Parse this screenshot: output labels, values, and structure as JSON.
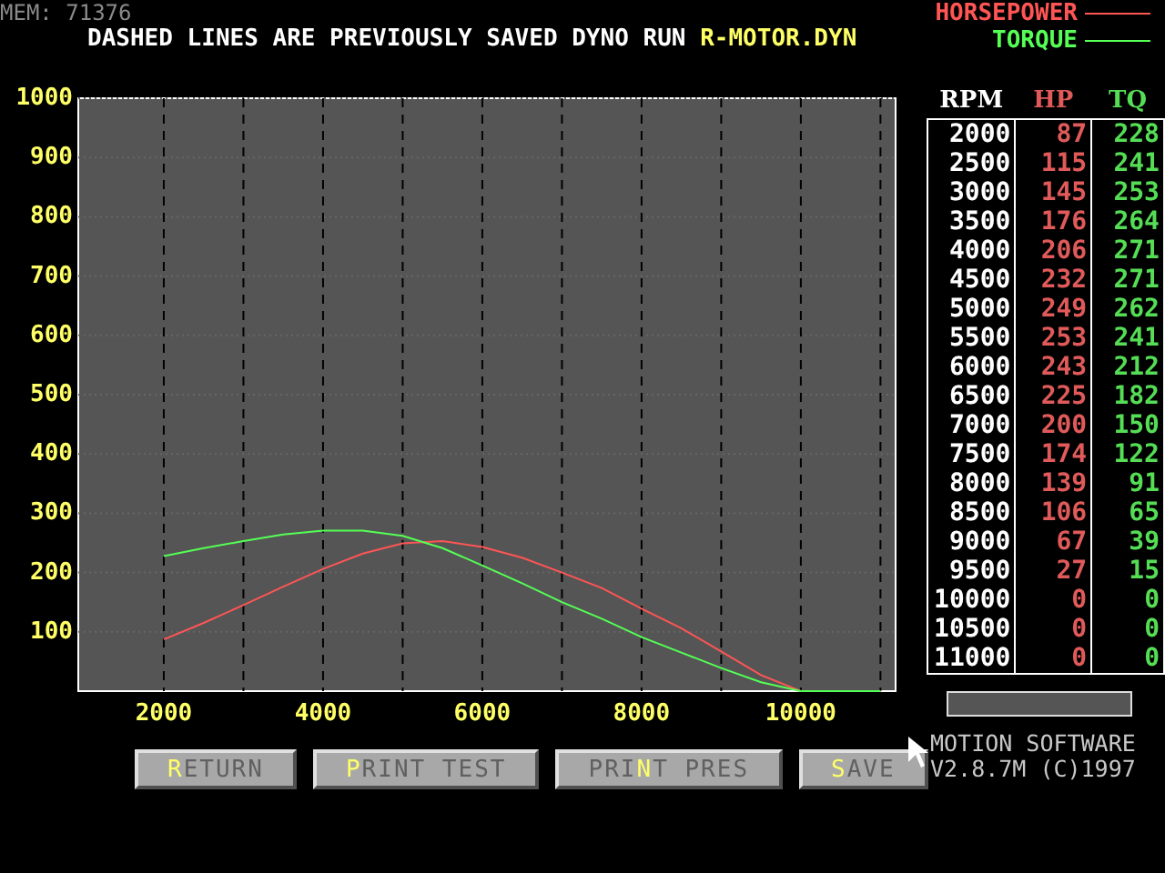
{
  "mem": "MEM: 71376",
  "title": {
    "text": "DASHED LINES ARE PREVIOUSLY SAVED DYNO RUN",
    "file": "R-MOTOR.DYN"
  },
  "chart": {
    "chart_data": {
      "type": "line",
      "grid": true,
      "x": [
        2000,
        2500,
        3000,
        3500,
        4000,
        4500,
        5000,
        5500,
        6000,
        6500,
        7000,
        7500,
        8000,
        8500,
        9000,
        9500,
        10000,
        10500,
        11000
      ],
      "series": [
        {
          "name": "HORSEPOWER",
          "color": "#ff5555",
          "values": [
            87,
            115,
            145,
            176,
            206,
            232,
            249,
            253,
            243,
            225,
            200,
            174,
            139,
            106,
            67,
            27,
            0,
            0,
            0
          ]
        },
        {
          "name": "TORQUE",
          "color": "#55ff55",
          "values": [
            228,
            241,
            253,
            264,
            271,
            271,
            262,
            241,
            212,
            182,
            150,
            122,
            91,
            65,
            39,
            15,
            0,
            0,
            0
          ]
        }
      ],
      "xlim": [
        926,
        11190
      ],
      "ylim": [
        0,
        1000
      ],
      "xticks": [
        2000,
        4000,
        6000,
        8000,
        10000
      ],
      "yticks": [
        100,
        200,
        300,
        400,
        500,
        600,
        700,
        800,
        900,
        1000
      ]
    }
  },
  "table": {
    "columns": [
      "RPM",
      "HP",
      "TQ"
    ],
    "rows": [
      [
        "2000",
        "87",
        "228"
      ],
      [
        "2500",
        "115",
        "241"
      ],
      [
        "3000",
        "145",
        "253"
      ],
      [
        "3500",
        "176",
        "264"
      ],
      [
        "4000",
        "206",
        "271"
      ],
      [
        "4500",
        "232",
        "271"
      ],
      [
        "5000",
        "249",
        "262"
      ],
      [
        "5500",
        "253",
        "241"
      ],
      [
        "6000",
        "243",
        "212"
      ],
      [
        "6500",
        "225",
        "182"
      ],
      [
        "7000",
        "200",
        "150"
      ],
      [
        "7500",
        "174",
        "122"
      ],
      [
        "8000",
        "139",
        "91"
      ],
      [
        "8500",
        "106",
        "65"
      ],
      [
        "9000",
        "67",
        "39"
      ],
      [
        "9500",
        "27",
        "15"
      ],
      [
        "10000",
        "0",
        "0"
      ],
      [
        "10500",
        "0",
        "0"
      ],
      [
        "11000",
        "0",
        "0"
      ]
    ]
  },
  "buttons": [
    {
      "key": "R",
      "after": "ETURN"
    },
    {
      "key": "P",
      "after": "RINT TEST"
    },
    {
      "before": "PRI",
      "key": "N",
      "after": "T PRES"
    },
    {
      "key": "S",
      "after": "AVE"
    }
  ],
  "progress": {
    "level": 0
  },
  "footer": [
    "MOTION SOFTWARE",
    "V2.8.7M (C)1997"
  ]
}
